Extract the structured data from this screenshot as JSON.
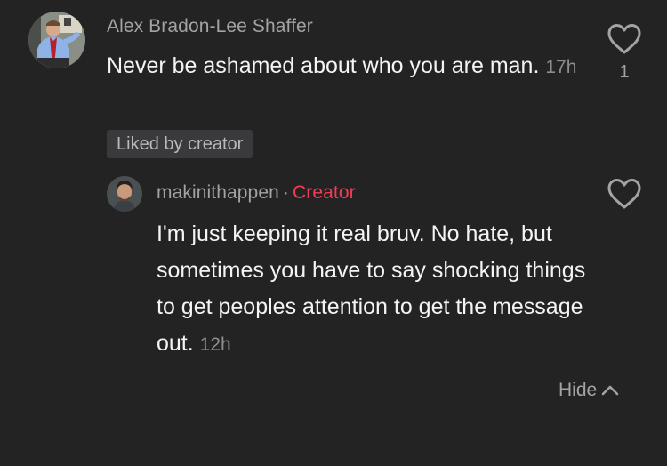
{
  "comment": {
    "username": "Alex Bradon-Lee Shaffer",
    "text": "Never be ashamed about who you are man.",
    "time": "17h",
    "liked_by_creator_label": "Liked by creator",
    "like_count": "1",
    "avatar_icon": "profile-photo-man-in-suit",
    "heart_icon": "heart-outline-icon"
  },
  "reply": {
    "username": "makinithappen",
    "separator": "·",
    "creator_label": "Creator",
    "text": "I'm just keeping it real bruv. No hate, but sometimes you have to say shocking things to get peoples attention to get the message out.",
    "time": "12h",
    "avatar_icon": "profile-photo-man",
    "heart_icon": "heart-outline-icon"
  },
  "hide_button": {
    "label": "Hide",
    "icon": "chevron-up-icon"
  },
  "colors": {
    "background": "#232324",
    "creator_accent": "#f23d57",
    "secondary_text": "#a3a3a5",
    "badge_bg": "#3a3a3c"
  }
}
